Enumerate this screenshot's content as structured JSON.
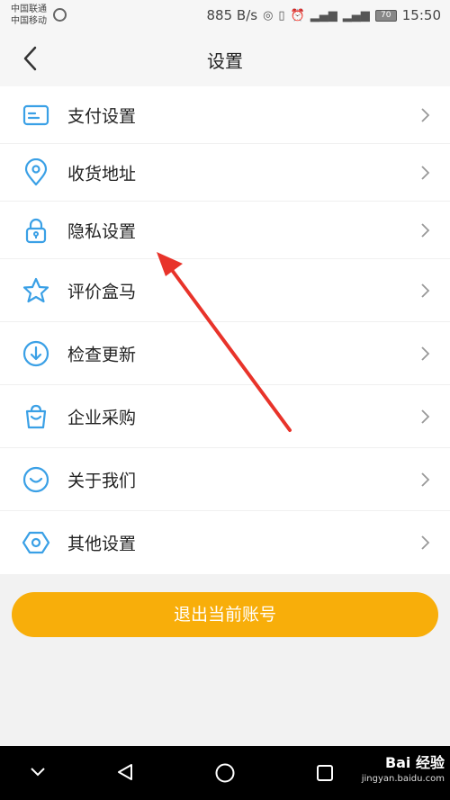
{
  "status_bar": {
    "carrier1": "中国联通",
    "carrier2": "中国移动",
    "speed": "885 B/s",
    "battery": "70",
    "time": "15:50"
  },
  "header": {
    "title": "设置"
  },
  "menu": [
    {
      "label": "支付设置",
      "icon": "card-icon"
    },
    {
      "label": "收货地址",
      "icon": "location-icon"
    },
    {
      "label": "隐私设置",
      "icon": "lock-icon"
    },
    {
      "label": "评价盒马",
      "icon": "star-icon"
    },
    {
      "label": "检查更新",
      "icon": "download-icon"
    },
    {
      "label": "企业采购",
      "icon": "bag-icon"
    },
    {
      "label": "关于我们",
      "icon": "smile-icon"
    },
    {
      "label": "其他设置",
      "icon": "hexagon-icon"
    }
  ],
  "logout_label": "退出当前账号",
  "watermark": {
    "brand": "Bai 经验",
    "url": "jingyan.baidu.com"
  },
  "colors": {
    "accent": "#f8ae0a",
    "icon": "#3aa0e6",
    "annotation_arrow": "#e8332a"
  }
}
